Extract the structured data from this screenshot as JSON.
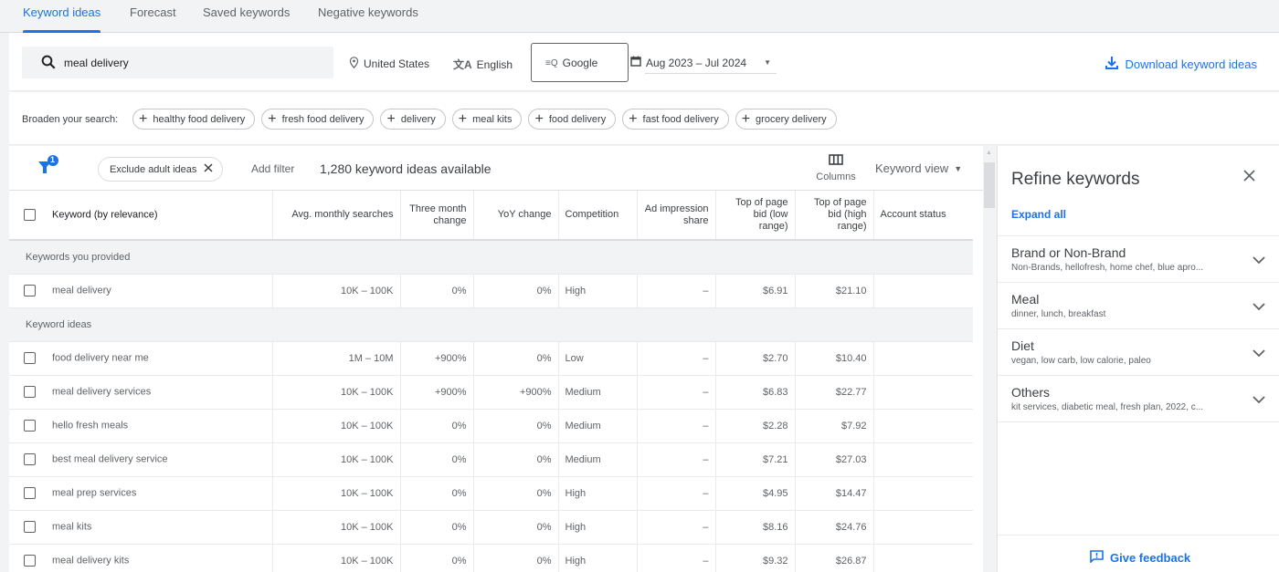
{
  "tabs": [
    {
      "label": "Keyword ideas",
      "active": true
    },
    {
      "label": "Forecast",
      "active": false
    },
    {
      "label": "Saved keywords",
      "active": false
    },
    {
      "label": "Negative keywords",
      "active": false
    }
  ],
  "search": {
    "value": "meal delivery",
    "icon": "search-icon"
  },
  "options": {
    "location": "United States",
    "language": "English",
    "network": "Google",
    "date_range": "Aug 2023 – Jul 2024"
  },
  "download_label": "Download keyword ideas",
  "broaden": {
    "label": "Broaden your search:",
    "chips": [
      "healthy food delivery",
      "fresh food delivery",
      "delivery",
      "meal kits",
      "food delivery",
      "fast food delivery",
      "grocery delivery"
    ]
  },
  "toolbar": {
    "filter_badge": "1",
    "exclude_chip": "Exclude adult ideas",
    "add_filter": "Add filter",
    "count": "1,280 keyword ideas available",
    "columns": "Columns",
    "keyword_view": "Keyword view"
  },
  "table": {
    "headers": [
      "Keyword (by relevance)",
      "Avg. monthly searches",
      "Three month change",
      "YoY change",
      "Competition",
      "Ad impression share",
      "Top of page bid (low range)",
      "Top of page bid (high range)",
      "Account status"
    ],
    "groups": [
      {
        "label": "Keywords you provided",
        "rows": [
          {
            "keyword": "meal delivery",
            "searches": "10K – 100K",
            "three_month": "0%",
            "yoy": "0%",
            "competition": "High",
            "impression": "–",
            "bid_low": "$6.91",
            "bid_high": "$21.10",
            "status": ""
          }
        ]
      },
      {
        "label": "Keyword ideas",
        "rows": [
          {
            "keyword": "food delivery near me",
            "searches": "1M – 10M",
            "three_month": "+900%",
            "yoy": "0%",
            "competition": "Low",
            "impression": "–",
            "bid_low": "$2.70",
            "bid_high": "$10.40",
            "status": ""
          },
          {
            "keyword": "meal delivery services",
            "searches": "10K – 100K",
            "three_month": "+900%",
            "yoy": "+900%",
            "competition": "Medium",
            "impression": "–",
            "bid_low": "$6.83",
            "bid_high": "$22.77",
            "status": ""
          },
          {
            "keyword": "hello fresh meals",
            "searches": "10K – 100K",
            "three_month": "0%",
            "yoy": "0%",
            "competition": "Medium",
            "impression": "–",
            "bid_low": "$2.28",
            "bid_high": "$7.92",
            "status": ""
          },
          {
            "keyword": "best meal delivery service",
            "searches": "10K – 100K",
            "three_month": "0%",
            "yoy": "0%",
            "competition": "Medium",
            "impression": "–",
            "bid_low": "$7.21",
            "bid_high": "$27.03",
            "status": ""
          },
          {
            "keyword": "meal prep services",
            "searches": "10K – 100K",
            "three_month": "0%",
            "yoy": "0%",
            "competition": "High",
            "impression": "–",
            "bid_low": "$4.95",
            "bid_high": "$14.47",
            "status": ""
          },
          {
            "keyword": "meal kits",
            "searches": "10K – 100K",
            "three_month": "0%",
            "yoy": "0%",
            "competition": "High",
            "impression": "–",
            "bid_low": "$8.16",
            "bid_high": "$24.76",
            "status": ""
          },
          {
            "keyword": "meal delivery kits",
            "searches": "10K – 100K",
            "three_month": "0%",
            "yoy": "0%",
            "competition": "High",
            "impression": "–",
            "bid_low": "$9.32",
            "bid_high": "$26.87",
            "status": ""
          }
        ]
      }
    ]
  },
  "refine": {
    "title": "Refine keywords",
    "expand_all": "Expand all",
    "items": [
      {
        "title": "Brand or Non-Brand",
        "subtitle": "Non-Brands, hellofresh, home chef, blue apro..."
      },
      {
        "title": "Meal",
        "subtitle": "dinner, lunch, breakfast"
      },
      {
        "title": "Diet",
        "subtitle": "vegan, low carb, low calorie, paleo"
      },
      {
        "title": "Others",
        "subtitle": "kit services, diabetic meal, fresh plan, 2022, c..."
      }
    ],
    "feedback": "Give feedback"
  },
  "colors": {
    "accent": "#1a73e8",
    "text": "#3c4043",
    "muted": "#5f6368",
    "background": "#f1f3f4"
  }
}
